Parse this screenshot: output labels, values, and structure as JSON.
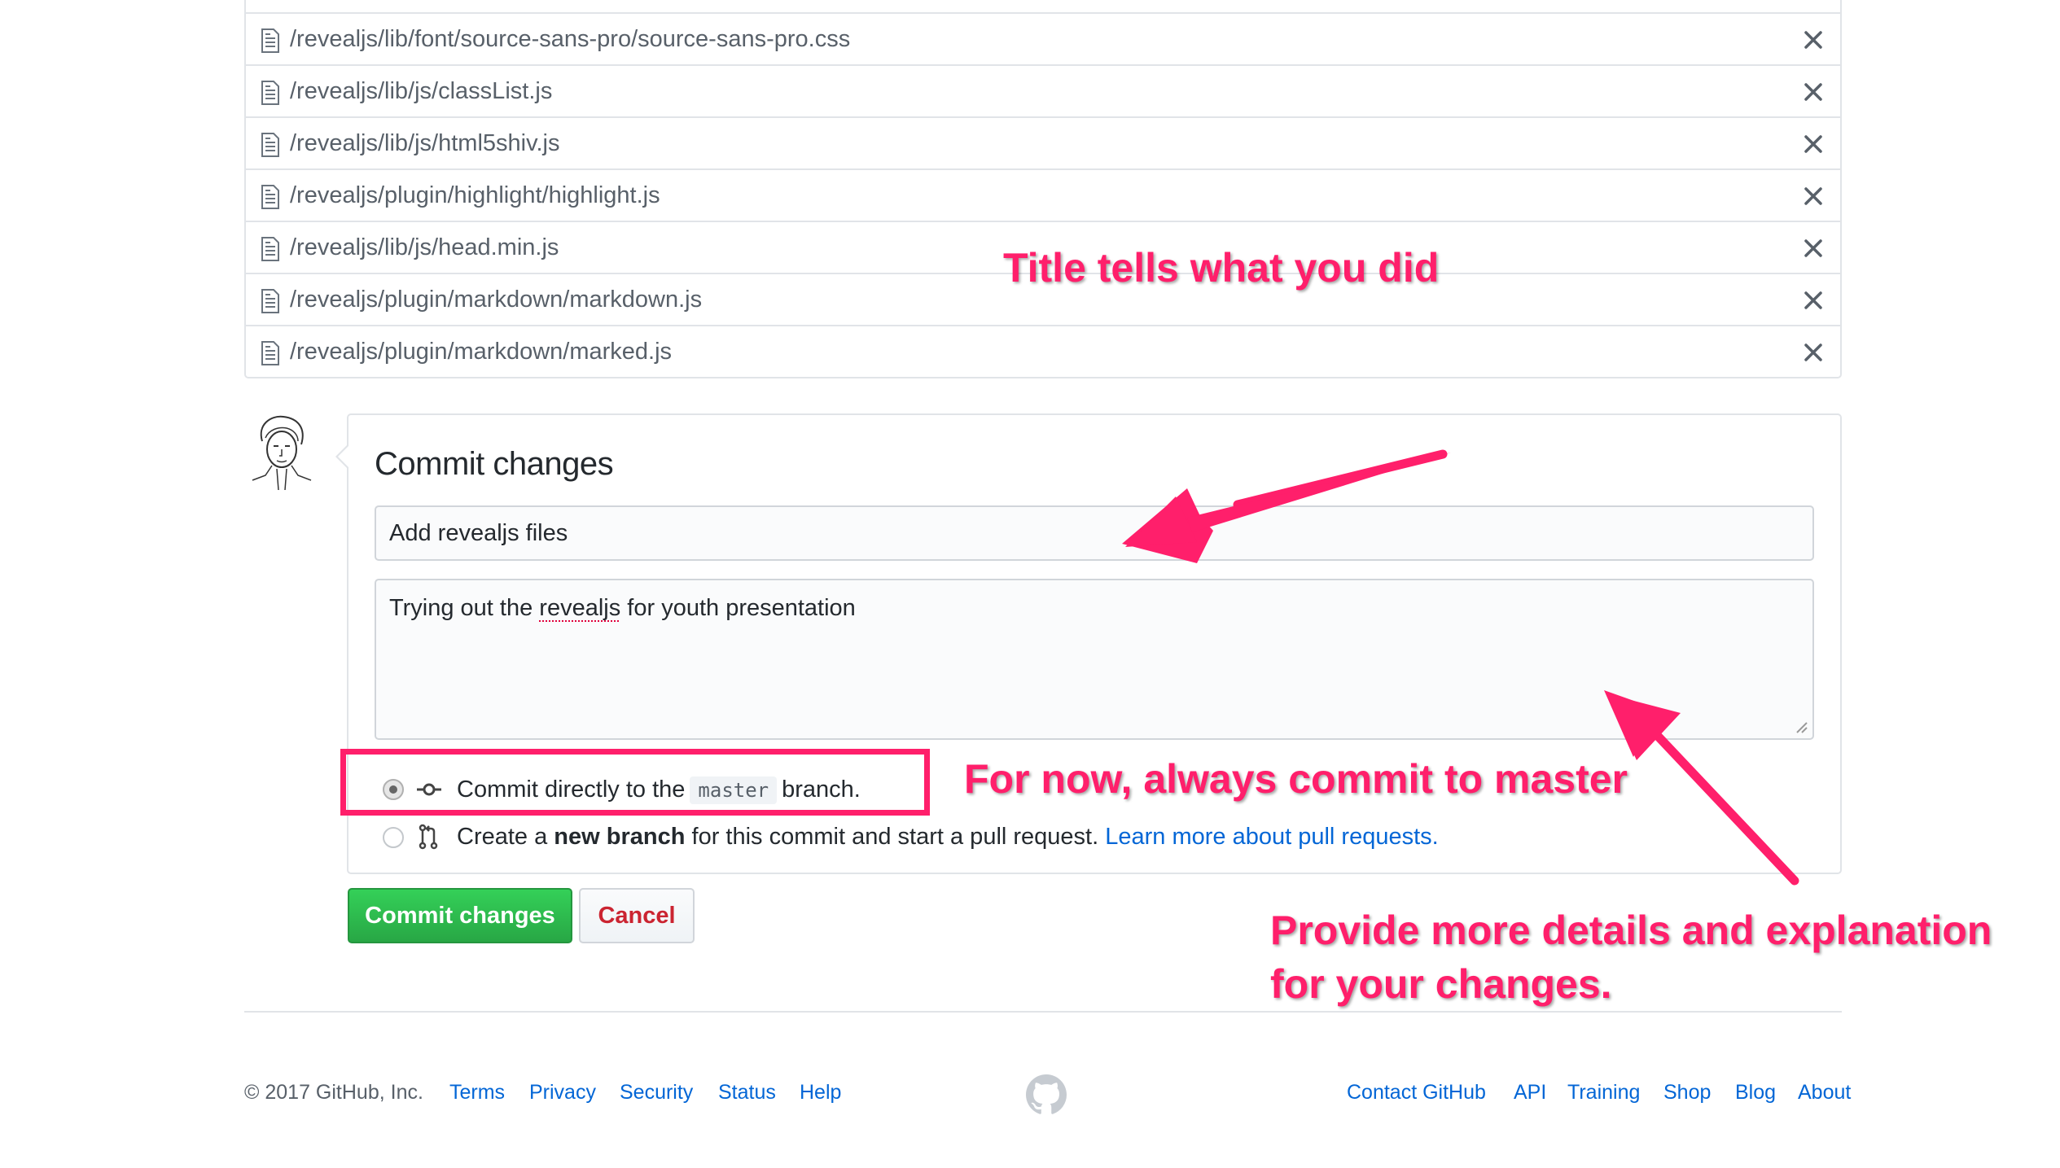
{
  "files": [
    {
      "path": "/revealjs/lib/font/source-sans-pro/source-sans-pro.css"
    },
    {
      "path": "/revealjs/lib/js/classList.js"
    },
    {
      "path": "/revealjs/lib/js/html5shiv.js"
    },
    {
      "path": "/revealjs/plugin/highlight/highlight.js"
    },
    {
      "path": "/revealjs/lib/js/head.min.js"
    },
    {
      "path": "/revealjs/plugin/markdown/markdown.js"
    },
    {
      "path": "/revealjs/plugin/markdown/marked.js"
    }
  ],
  "commit": {
    "heading": "Commit changes",
    "summary_value": "Add revealjs files",
    "description": {
      "before": "Trying out the ",
      "misspelled": "revealjs",
      "after": " for youth presentation"
    },
    "option_direct": {
      "prefix": "Commit directly to the",
      "branch": "master",
      "suffix": "branch.",
      "selected": true
    },
    "option_new_branch": {
      "prefix": "Create a",
      "bold": "new branch",
      "middle": "for this commit and start a pull request.",
      "link": "Learn more about pull requests."
    },
    "submit_label": "Commit changes",
    "cancel_label": "Cancel"
  },
  "footer": {
    "copyright": "© 2017 GitHub, Inc.",
    "left_links": [
      "Terms",
      "Privacy",
      "Security",
      "Status",
      "Help"
    ],
    "right_links": [
      "Contact GitHub",
      "API",
      "Training",
      "Shop",
      "Blog",
      "About"
    ]
  },
  "annotations": {
    "title_note": "Title tells what you did",
    "master_note": "For now, always commit to master",
    "details_note_line1": "Provide more details and explanation",
    "details_note_line2": "for your changes."
  },
  "icons": {
    "file": "file-text-icon",
    "remove": "x-icon",
    "commit": "git-commit-icon",
    "pull_request": "git-pull-request-icon",
    "footer_logo": "github-mark-icon"
  },
  "colors": {
    "annotation": "#ff1f6b",
    "commit_button": "#28a745",
    "cancel_text": "#cb2431",
    "link": "#0366d6"
  }
}
